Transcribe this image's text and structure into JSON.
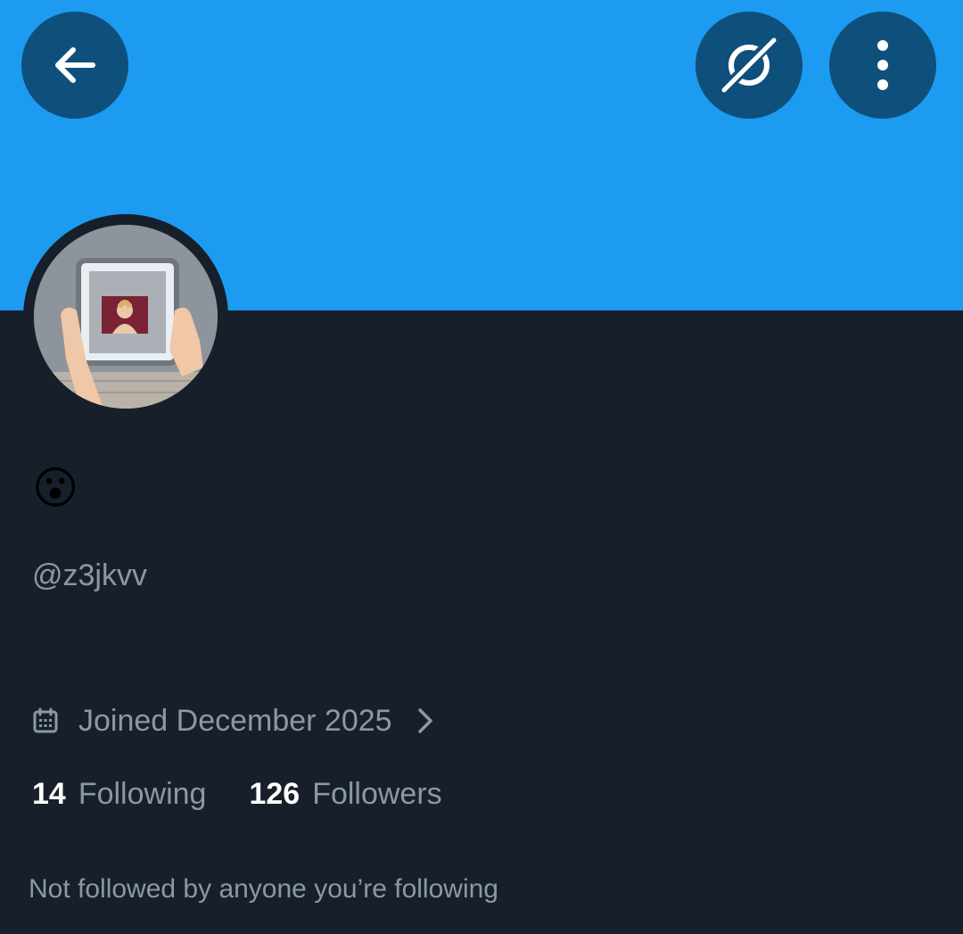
{
  "header": {
    "back_icon": "arrow-left-icon",
    "grok_icon": "grok-icon",
    "more_icon": "more-vertical-icon",
    "banner_color": "#1d9bf0",
    "button_color": "#0f4f7c"
  },
  "profile": {
    "avatar_icon": "ring-light-photo",
    "display_name_emoji": "😮",
    "handle": "@z3jkvv",
    "joined": "Joined December 2025",
    "calendar_icon": "calendar-icon",
    "chevron_icon": "chevron-right-icon"
  },
  "stats": {
    "following_count": "14",
    "following_label": "Following",
    "followers_count": "126",
    "followers_label": "Followers"
  },
  "social_context": "Not followed by anyone you’re following",
  "theme": {
    "background": "#17202a",
    "secondary_text": "#8b98a5",
    "primary_text": "#ffffff"
  }
}
